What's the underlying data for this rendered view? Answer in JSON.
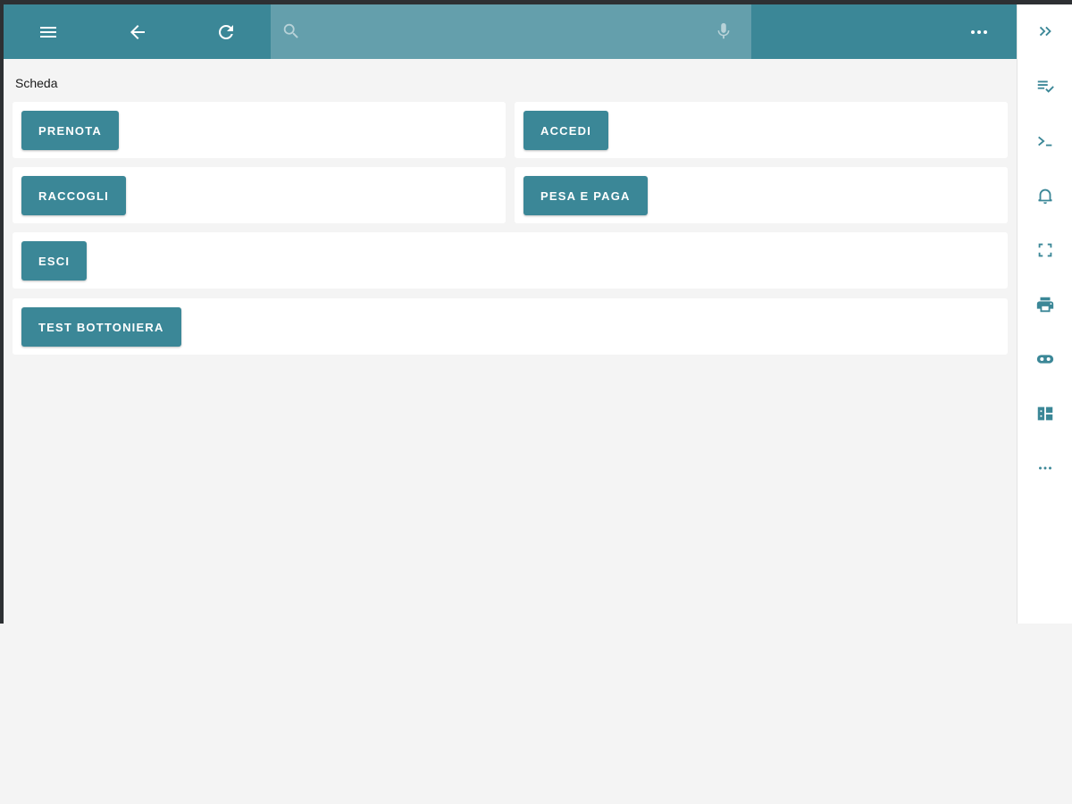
{
  "toolbar": {
    "menu_icon": "menu-icon",
    "back_icon": "arrow-back-icon",
    "refresh_icon": "refresh-icon",
    "search": {
      "placeholder": "",
      "value": ""
    },
    "more_icon": "more-horizontal-icon"
  },
  "page": {
    "section_title": "Scheda",
    "buttons": {
      "prenota": "PRENOTA",
      "accedi": "ACCEDI",
      "raccogli": "RACCOGLI",
      "pesa_e_paga": "PESA E PAGA",
      "esci": "ESCI",
      "test_bottoniera": "TEST BOTTONIERA"
    }
  },
  "sidebar": {
    "icons": [
      "expand-icon",
      "checklist-icon",
      "terminal-icon",
      "notification-bell-icon",
      "fullscreen-icon",
      "print-icon",
      "gamepad-icon",
      "dashboard-icon",
      "more-horizontal-icon"
    ]
  },
  "colors": {
    "accent": "#3b8797",
    "search_bg": "#649fac",
    "background": "#f4f4f4",
    "card": "#ffffff"
  }
}
